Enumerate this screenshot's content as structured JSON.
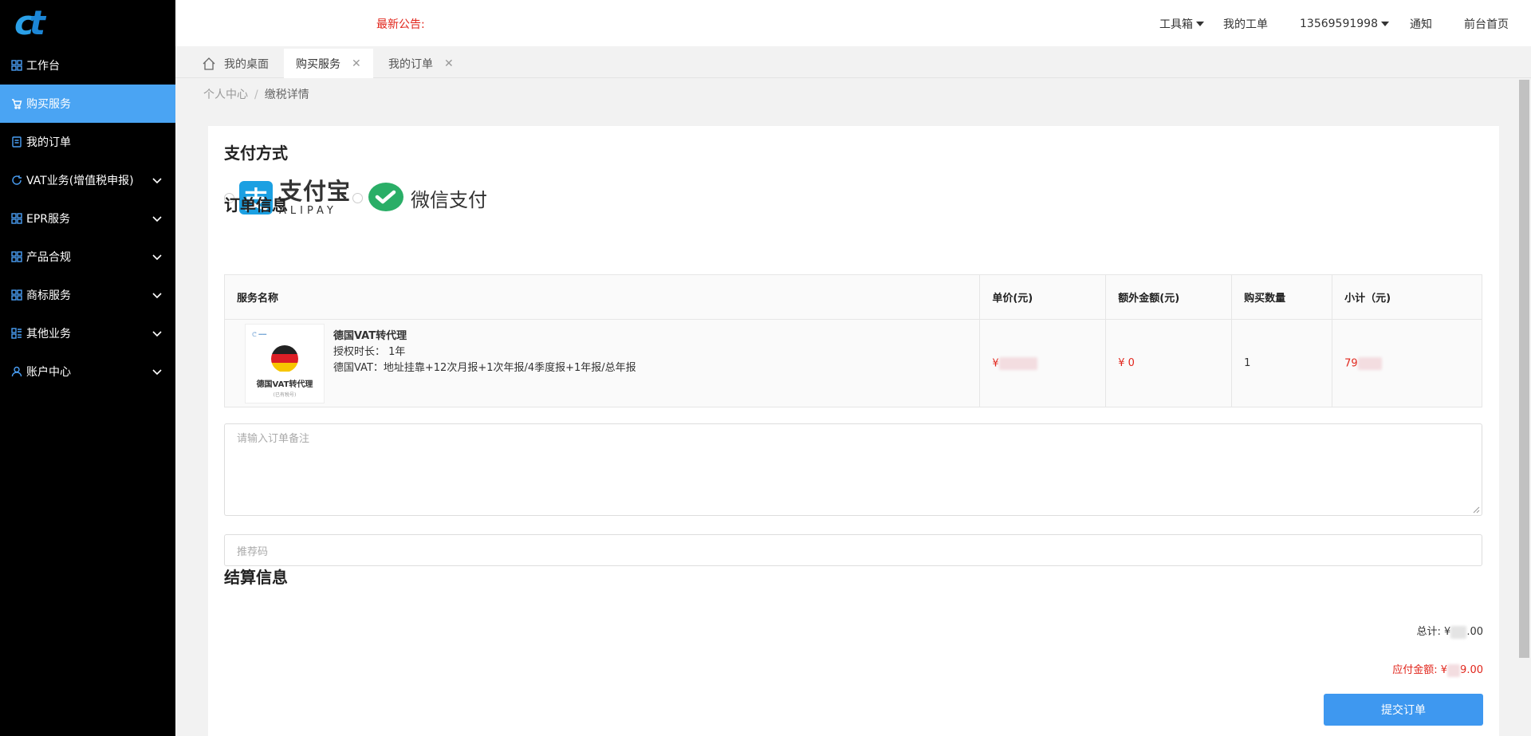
{
  "header": {
    "notice_label": "最新公告:",
    "nav": {
      "toolbox": "工具箱",
      "my_ticket": "我的工单",
      "phone": "13569591998",
      "notify": "通知",
      "front_home": "前台首页"
    }
  },
  "sidebar": {
    "items": [
      {
        "label": "工作台",
        "icon": "grid-icon",
        "expandable": false
      },
      {
        "label": "购买服务",
        "icon": "cart-icon",
        "expandable": false,
        "active": true
      },
      {
        "label": "我的订单",
        "icon": "order-icon",
        "expandable": false
      },
      {
        "label": "VAT业务(增值税申报)",
        "icon": "refresh-icon",
        "expandable": true
      },
      {
        "label": "EPR服务",
        "icon": "grid-icon",
        "expandable": true
      },
      {
        "label": "产品合规",
        "icon": "grid-icon",
        "expandable": true
      },
      {
        "label": "商标服务",
        "icon": "grid-icon",
        "expandable": true
      },
      {
        "label": "其他业务",
        "icon": "list-grid-icon",
        "expandable": true
      },
      {
        "label": "账户中心",
        "icon": "user-icon",
        "expandable": true
      }
    ]
  },
  "tabs": [
    {
      "label": "我的桌面",
      "closable": false
    },
    {
      "label": "购买服务",
      "closable": true,
      "active": true
    },
    {
      "label": "我的订单",
      "closable": true
    }
  ],
  "breadcrumb": {
    "root": "个人中心",
    "separator": "/",
    "current": "缴税详情"
  },
  "payment": {
    "title": "支付方式",
    "alipay_cn": "支付宝",
    "alipay_en": "ALIPAY",
    "wechat": "微信支付"
  },
  "order": {
    "title": "订单信息",
    "columns": [
      "服务名称",
      "单价(元)",
      "额外金额(元)",
      "购买数量",
      "小计（元)"
    ],
    "item": {
      "image_title": "德国VAT转代理",
      "image_sub": "(已有税号)",
      "name": "德国VAT转代理",
      "duration": "授权时长： 1年",
      "desc": "德国VAT：地址挂靠+12次月报+1次年报/4季度报+1年报/总年报",
      "unit_price": "¥",
      "extra": "¥ 0",
      "qty": "1",
      "subtotal": "79"
    }
  },
  "remark": {
    "placeholder": "请输入订单备注"
  },
  "ref_code": {
    "placeholder": "推荐码"
  },
  "settlement": {
    "title": "结算信息",
    "total_label": "总计:",
    "total_currency": "¥",
    "total_tail": ".00",
    "due_label": "应付金额:",
    "due_currency": "¥",
    "due_tail": "9.00"
  },
  "submit_label": "提交订单",
  "colors": {
    "sidebar_bg": "#000000",
    "active": "#4aa4f3",
    "accent_red": "#e1251b",
    "button": "#3e98f0",
    "alipay": "#1ba0e2",
    "wechat": "#2aae67"
  }
}
